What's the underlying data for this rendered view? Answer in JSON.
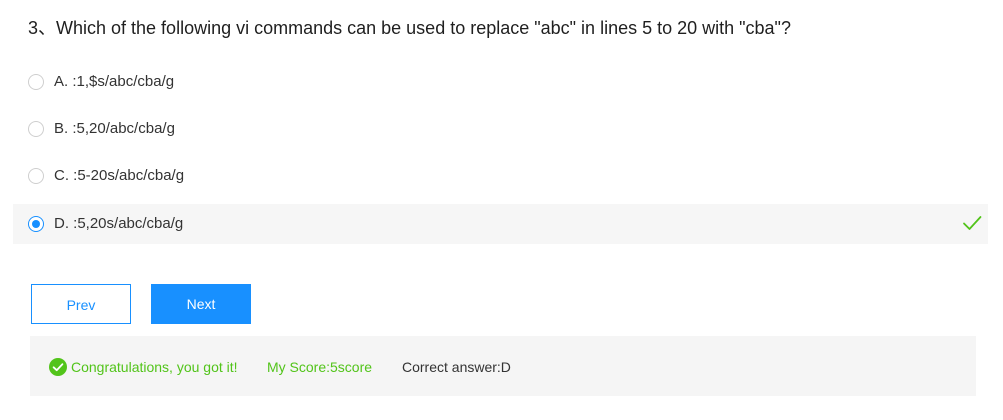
{
  "question": {
    "text": "3、Which of the following vi commands can be used to replace \"abc\" in lines 5 to 20 with \"cba\"?"
  },
  "options": [
    {
      "label": "A. :1,$s/abc/cba/g",
      "selected": false
    },
    {
      "label": "B. :5,20/abc/cba/g",
      "selected": false
    },
    {
      "label": "C. :5-20s/abc/cba/g",
      "selected": false
    },
    {
      "label": "D. :5,20s/abc/cba/g",
      "selected": true,
      "marked_correct": true
    }
  ],
  "buttons": {
    "prev_label": "Prev",
    "next_label": "Next"
  },
  "result": {
    "message": "Congratulations, you got it!",
    "score": "My Score:5score",
    "correct_answer": "Correct answer:D"
  },
  "colors": {
    "accent": "#1890ff",
    "success": "#52c41a",
    "selected_row_bg": "#f6f6f6",
    "result_bg": "#f5f5f5"
  },
  "icons": {
    "radio_checked": "radio-checked-icon",
    "correct_mark": "checkmark-icon",
    "success_badge": "check-circle-icon"
  }
}
